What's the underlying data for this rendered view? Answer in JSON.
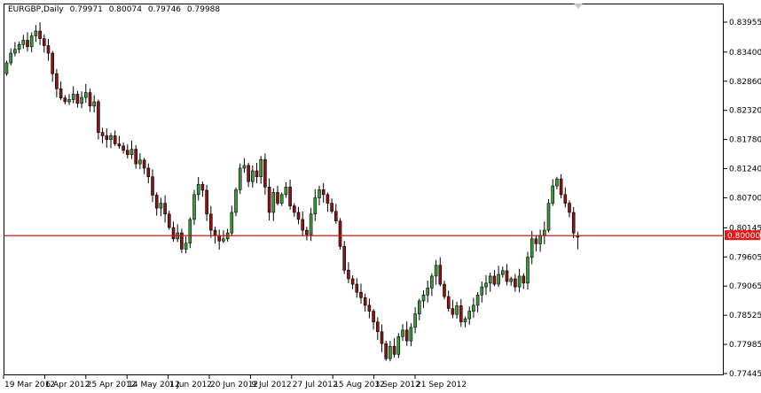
{
  "header": {
    "symbol_period": "EURGBP,Daily",
    "open": "0.79971",
    "high": "0.80074",
    "low": "0.79746",
    "close": "0.79988"
  },
  "colors": {
    "bull": "#3a9a3a",
    "bear": "#8b1414",
    "outline": "#000000",
    "level_line": "#cc0000",
    "level_label_bg": "#ee1111"
  },
  "chart_data": {
    "type": "candlestick",
    "title": "EURGBP,Daily",
    "ylim": [
      0.77445,
      0.83955
    ],
    "y_ticks": [
      "0.83955",
      "0.83400",
      "0.82860",
      "0.82320",
      "0.81780",
      "0.81240",
      "0.80700",
      "0.80145",
      "0.79605",
      "0.79065",
      "0.78525",
      "0.77985",
      "0.77445"
    ],
    "x_ticks": [
      {
        "label": "19 Mar 2012",
        "bar": 0
      },
      {
        "label": "6 Apr 2012",
        "bar": 10
      },
      {
        "label": "25 Apr 2012",
        "bar": 20
      },
      {
        "label": "14 May 2012",
        "bar": 30
      },
      {
        "label": "1 Jun 2012",
        "bar": 40
      },
      {
        "label": "20 Jun 2012",
        "bar": 50
      },
      {
        "label": "9 Jul 2012",
        "bar": 60
      },
      {
        "label": "27 Jul 2012",
        "bar": 70
      },
      {
        "label": "15 Aug 2012",
        "bar": 80
      },
      {
        "label": "3 Sep 2012",
        "bar": 90
      },
      {
        "label": "21 Sep 2012",
        "bar": 100
      }
    ],
    "horizontal_line": {
      "price": 0.8,
      "label": "0.80000"
    },
    "first_open": 0.83,
    "last_bar": {
      "open": 0.79971,
      "high": 0.80074,
      "low": 0.79746,
      "close": 0.79988
    },
    "closes": [
      0.832,
      0.8338,
      0.8345,
      0.8354,
      0.8362,
      0.835,
      0.837,
      0.8379,
      0.8365,
      0.8352,
      0.8338,
      0.83,
      0.8272,
      0.8255,
      0.8248,
      0.8252,
      0.8262,
      0.8245,
      0.8256,
      0.8265,
      0.824,
      0.8248,
      0.8191,
      0.8185,
      0.8178,
      0.8185,
      0.817,
      0.8166,
      0.8158,
      0.815,
      0.816,
      0.8133,
      0.814,
      0.8125,
      0.8109,
      0.8075,
      0.8051,
      0.806,
      0.804,
      0.8015,
      0.7994,
      0.8005,
      0.7975,
      0.7986,
      0.803,
      0.8076,
      0.8095,
      0.8084,
      0.804,
      0.801,
      0.8,
      0.799,
      0.7994,
      0.8005,
      0.8043,
      0.8085,
      0.8125,
      0.813,
      0.81,
      0.812,
      0.8109,
      0.8141,
      0.809,
      0.8043,
      0.808,
      0.806,
      0.8076,
      0.809,
      0.8055,
      0.8043,
      0.803,
      0.801,
      0.8002,
      0.804,
      0.807,
      0.8085,
      0.8076,
      0.806,
      0.8045,
      0.8027,
      0.798,
      0.7936,
      0.792,
      0.791,
      0.7895,
      0.7885,
      0.7871,
      0.786,
      0.784,
      0.7822,
      0.78,
      0.7772,
      0.7795,
      0.778,
      0.7813,
      0.7825,
      0.7805,
      0.783,
      0.7855,
      0.7879,
      0.789,
      0.7903,
      0.7925,
      0.7945,
      0.791,
      0.7887,
      0.7865,
      0.7854,
      0.787,
      0.784,
      0.7846,
      0.786,
      0.7871,
      0.789,
      0.7905,
      0.7912,
      0.7925,
      0.791,
      0.7928,
      0.7935,
      0.7915,
      0.792,
      0.7905,
      0.7925,
      0.7912,
      0.796,
      0.7994,
      0.7985,
      0.8,
      0.801,
      0.806,
      0.8092,
      0.8105,
      0.8076,
      0.806,
      0.8043,
      0.8005,
      0.7999
    ]
  }
}
